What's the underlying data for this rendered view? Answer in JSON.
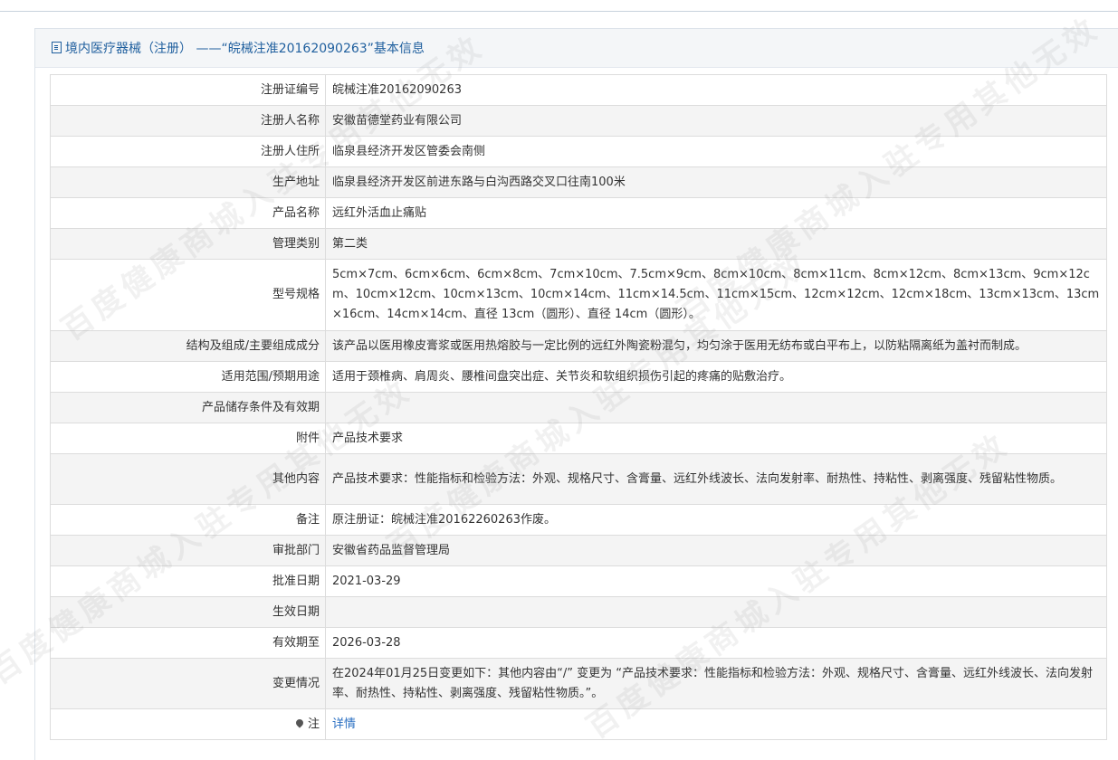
{
  "header": {
    "title": "境内医疗器械（注册） ——“皖械注准20162090263”基本信息"
  },
  "rows": [
    {
      "label": "注册证编号",
      "value": "皖械注准20162090263"
    },
    {
      "label": "注册人名称",
      "value": "安徽苗德堂药业有限公司"
    },
    {
      "label": "注册人住所",
      "value": "临泉县经济开发区管委会南侧"
    },
    {
      "label": "生产地址",
      "value": "临泉县经济开发区前进东路与白沟西路交叉口往南100米"
    },
    {
      "label": "产品名称",
      "value": "远红外活血止痛贴"
    },
    {
      "label": "管理类别",
      "value": "第二类"
    },
    {
      "label": "型号规格",
      "value": "5cm×7cm、6cm×6cm、6cm×8cm、7cm×10cm、7.5cm×9cm、8cm×10cm、8cm×11cm、8cm×12cm、8cm×13cm、9cm×12cm、10cm×12cm、10cm×13cm、10cm×14cm、11cm×14.5cm、11cm×15cm、12cm×12cm、12cm×18cm、13cm×13cm、13cm×16cm、14cm×14cm、直径 13cm（圆形）、直径 14cm（圆形）。"
    },
    {
      "label": "结构及组成/主要组成成分",
      "value": "该产品以医用橡皮膏浆或医用热熔胶与一定比例的远红外陶瓷粉混匀，均匀涂于医用无纺布或白平布上，以防粘隔离纸为盖衬而制成。"
    },
    {
      "label": "适用范围/预期用途",
      "value": "适用于颈椎病、肩周炎、腰椎间盘突出症、关节炎和软组织损伤引起的疼痛的贴敷治疗。"
    },
    {
      "label": "产品储存条件及有效期",
      "value": ""
    },
    {
      "label": "附件",
      "value": "产品技术要求"
    },
    {
      "label": "其他内容",
      "value": "产品技术要求：性能指标和检验方法：外观、规格尺寸、含膏量、远红外线波长、法向发射率、耐热性、持粘性、剥离强度、残留粘性物质。"
    },
    {
      "label": "备注",
      "value": "原注册证：皖械注准20162260263作废。"
    },
    {
      "label": "审批部门",
      "value": "安徽省药品监督管理局"
    },
    {
      "label": "批准日期",
      "value": "2021-03-29"
    },
    {
      "label": "生效日期",
      "value": ""
    },
    {
      "label": "有效期至",
      "value": "2026-03-28"
    },
    {
      "label": "变更情况",
      "value": "在2024年01月25日变更如下：其他内容由“/” 变更为 “产品技术要求：性能指标和检验方法：外观、规格尺寸、含膏量、远红外线波长、法向发射率、耐热性、持粘性、剥离强度、残留粘性物质。”。"
    }
  ],
  "note": {
    "label": "注",
    "icon": "map-pin-icon",
    "link": "详情"
  },
  "watermark": {
    "text": "百度健康商城入驻专用其他无效"
  },
  "colors": {
    "header_text": "#1f5f9e",
    "link": "#2a6fc2",
    "row_alt": "#f4f4f4"
  }
}
